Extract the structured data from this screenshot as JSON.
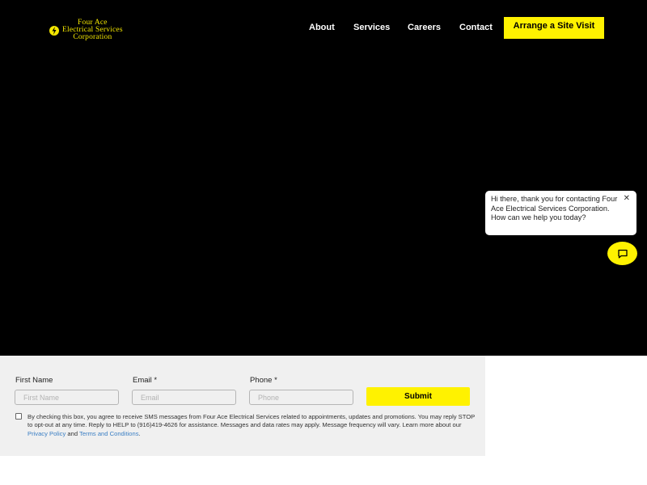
{
  "brand": {
    "line1": "Four Ace",
    "line2": "Electrical Services",
    "line3": "Corporation",
    "color": "#f3e600"
  },
  "nav": {
    "items": [
      {
        "label": "About"
      },
      {
        "label": "Services"
      },
      {
        "label": "Careers"
      },
      {
        "label": "Contact"
      }
    ],
    "cta_label": "Arrange a Site Visit"
  },
  "chat": {
    "message": "Hi there, thank you for contacting Four Ace Electrical Services Corporation. How can we help you today?",
    "close_icon": "close-icon",
    "launcher_icon": "chat-icon"
  },
  "form": {
    "first_name": {
      "label": "First Name",
      "placeholder": "First Name",
      "value": ""
    },
    "email": {
      "label": "Email *",
      "placeholder": "Email",
      "value": ""
    },
    "phone": {
      "label": "Phone *",
      "placeholder": "Phone",
      "value": ""
    },
    "submit_label": "Submit",
    "consent_text": "By checking this box, you agree to receive SMS messages from Four Ace Electrical Services related to appointments, updates and promotions. You may reply STOP to opt-out at any time. Reply to HELP to (916)419-4626 for assistance. Messages and data rates may apply. Message frequency will vary. Learn more about our",
    "privacy_link": "Privacy Policy",
    "and_text": "and",
    "terms_link": "Terms and Conditions",
    "period": ".",
    "consent_checked": false
  },
  "colors": {
    "accent": "#fff200",
    "hero_bg": "#000000",
    "form_bg": "#f0f0f0",
    "link": "#3b7fc4"
  }
}
